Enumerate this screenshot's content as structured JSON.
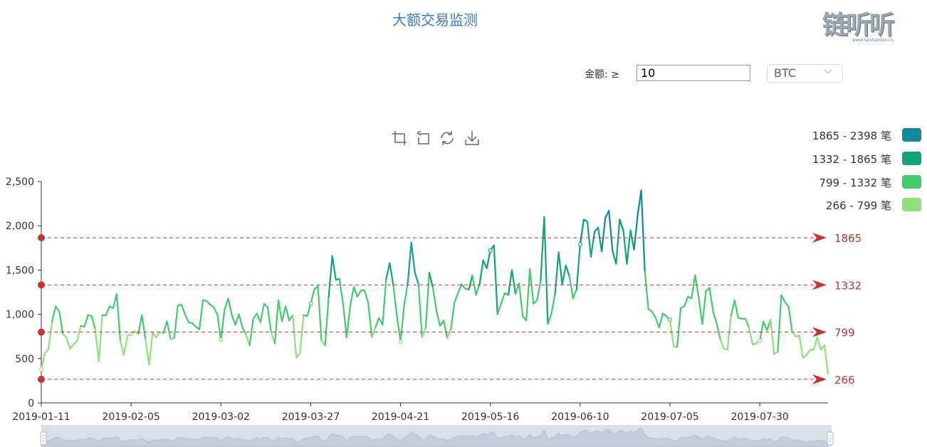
{
  "title": "大额交易监测",
  "logo": {
    "text": "链听听",
    "sub": "www.liandaodao.cn"
  },
  "filter": {
    "label": "金额: ≥",
    "amount_value": "10",
    "coin_selected": "BTC"
  },
  "toolbox": [
    "zoom-icon",
    "zoom-reset-icon",
    "restore-icon",
    "download-icon"
  ],
  "legend": [
    {
      "label": "1865 - 2398 笔",
      "color": "#0e8a9c"
    },
    {
      "label": "1332 - 1865 笔",
      "color": "#11a37c"
    },
    {
      "label": "799 - 1332 笔",
      "color": "#45c96e"
    },
    {
      "label": "266 - 799 笔",
      "color": "#8ee07a"
    }
  ],
  "chart_data": {
    "type": "line",
    "x_start": "2019-01-11",
    "x_end": "2019-08-18",
    "x_ticks": [
      "2019-01-11",
      "2019-02-05",
      "2019-03-02",
      "2019-03-27",
      "2019-04-21",
      "2019-05-16",
      "2019-06-10",
      "2019-07-05",
      "2019-07-30"
    ],
    "y_ticks": [
      "0",
      "500",
      "1,000",
      "1,500",
      "2,000",
      "2,500"
    ],
    "ylim": [
      0,
      2500
    ],
    "mark_lines": [
      {
        "value": 1865,
        "label": "1865"
      },
      {
        "value": 1332,
        "label": "1332"
      },
      {
        "value": 799,
        "label": "799"
      },
      {
        "value": 266,
        "label": "266"
      }
    ],
    "mark_color": "#c23531",
    "visual_map_colors": [
      "#8ee07a",
      "#45c96e",
      "#11a37c",
      "#0e8a9c"
    ],
    "series": [
      {
        "values": [
          380,
          560,
          610,
          920,
          1090,
          1030,
          780,
          740,
          610,
          660,
          700,
          870,
          860,
          990,
          980,
          830,
          470,
          990,
          990,
          1090,
          1070,
          1230,
          700,
          540,
          760,
          780,
          810,
          780,
          990,
          720,
          430,
          800,
          740,
          800,
          790,
          920,
          720,
          730,
          1100,
          1110,
          1000,
          910,
          900,
          860,
          830,
          1160,
          1150,
          1110,
          1080,
          1000,
          710,
          1050,
          1180,
          1000,
          880,
          1000,
          850,
          770,
          650,
          950,
          1010,
          910,
          1120,
          1080,
          790,
          670,
          1160,
          920,
          1090,
          930,
          990,
          510,
          560,
          990,
          980,
          1120,
          1280,
          1320,
          700,
          650,
          1200,
          1660,
          1390,
          1400,
          1120,
          740,
          1100,
          1310,
          1200,
          1270,
          1270,
          1130,
          740,
          850,
          960,
          880,
          1400,
          1580,
          1320,
          980,
          690,
          1100,
          1350,
          1810,
          1470,
          1340,
          740,
          850,
          1470,
          1300,
          1040,
          870,
          930,
          730,
          830,
          1130,
          1240,
          1340,
          1290,
          1280,
          1440,
          1220,
          1340,
          1610,
          1520,
          1720,
          1780,
          1000,
          1120,
          1240,
          1220,
          1500,
          1230,
          1350,
          980,
          930,
          1510,
          1120,
          1160,
          1380,
          2100,
          890,
          1010,
          1230,
          1700,
          1340,
          1550,
          1430,
          1180,
          1280,
          1790,
          2070,
          2050,
          1650,
          1930,
          1980,
          1710,
          2090,
          2170,
          1720,
          1570,
          2070,
          1950,
          1570,
          1950,
          1730,
          2120,
          2400,
          1480,
          1060,
          1030,
          960,
          850,
          1010,
          980,
          940,
          640,
          630,
          1070,
          1090,
          1200,
          1180,
          1440,
          1190,
          890,
          1260,
          1300,
          1030,
          900,
          720,
          610,
          600,
          990,
          1160,
          960,
          950,
          950,
          850,
          660,
          670,
          700,
          920,
          820,
          940,
          550,
          580,
          1220,
          1140,
          1090,
          810,
          750,
          760,
          510,
          540,
          600,
          600,
          740,
          600,
          650,
          330
        ]
      }
    ]
  }
}
